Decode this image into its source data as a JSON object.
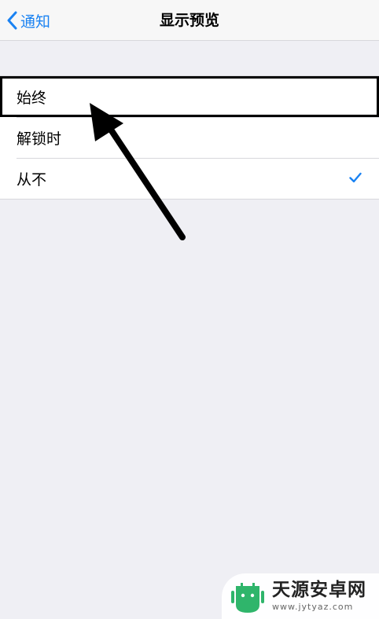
{
  "nav": {
    "back_label": "通知",
    "title": "显示预览"
  },
  "options": [
    {
      "label": "始终",
      "selected": false,
      "highlighted": true
    },
    {
      "label": "解锁时",
      "selected": false,
      "highlighted": false
    },
    {
      "label": "从不",
      "selected": true,
      "highlighted": false
    }
  ],
  "icons": {
    "back": "chevron-left-icon",
    "check": "checkmark-icon",
    "annotation": "arrow-icon"
  },
  "colors": {
    "accent": "#1a82f2",
    "background": "#efeff4",
    "annotation": "#000000"
  },
  "watermark": {
    "title": "天源安卓网",
    "url": "www.jytyaz.com"
  }
}
